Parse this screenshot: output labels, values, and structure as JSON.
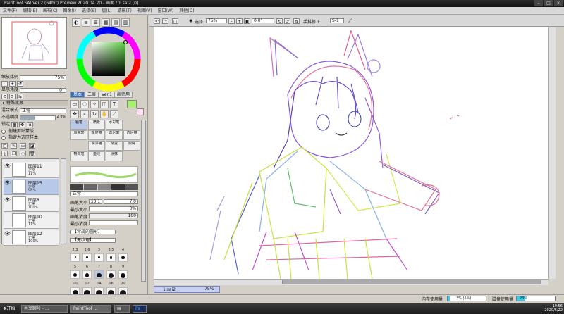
{
  "window": {
    "title": "PaintTool SAI Ver.2 (64bit) Preview.2020.04.20 - 画面 / 1.sai2 [0]",
    "controls": [
      "–",
      "□",
      "×"
    ]
  },
  "menu": [
    "文件(F)",
    "编辑(E)",
    "画布(C)",
    "图像(I)",
    "选择(S)",
    "层(L)",
    "滤镜(T)",
    "视图(V)",
    "窗口(W)",
    "其他(O)"
  ],
  "navigator": {
    "zoom_label": "缩放比例",
    "zoom_value": "75%",
    "angle_label": "显示角度",
    "angle_value": "0°"
  },
  "effects": {
    "header": "特殊效果",
    "blend_label": "混合模式",
    "blend_value": "正常",
    "opacity_label": "不透明度",
    "opacity_value": "43%",
    "lock_label": "锁定",
    "clip_label": "创建剪贴蒙版",
    "selsrc_label": "指定为选区样本"
  },
  "layers": [
    {
      "name": "图层11",
      "mode": "正常",
      "opacity": "11%",
      "selected": false,
      "visible": true
    },
    {
      "name": "图层15",
      "mode": "正常",
      "opacity": "98%",
      "selected": true,
      "visible": true
    },
    {
      "name": "图层8",
      "mode": "正常",
      "opacity": "100%",
      "selected": false,
      "visible": true
    },
    {
      "name": "图层10",
      "mode": "正常",
      "opacity": "11%",
      "selected": false,
      "visible": false
    },
    {
      "name": "图层12",
      "mode": "正常",
      "opacity": "100%",
      "selected": false,
      "visible": true
    }
  ],
  "toolpanel": {
    "color_tabs": [
      "基本",
      "二值",
      "Ver.1",
      "画师用"
    ],
    "tools": [
      {
        "name": "铅笔",
        "sel": true
      },
      {
        "name": "喷枪",
        "sel": false
      },
      {
        "name": "水彩笔",
        "sel": false
      },
      {
        "name": "马克笔",
        "sel": false
      },
      {
        "name": "橡皮擦",
        "sel": false
      },
      {
        "name": "选区笔",
        "sel": false
      },
      {
        "name": "选区擦",
        "sel": false
      },
      {
        "name": "油漆桶",
        "sel": false
      },
      {
        "name": "渐变",
        "sel": false
      },
      {
        "name": "模糊",
        "sel": false
      },
      {
        "name": "特效笔",
        "sel": false
      },
      {
        "name": "墨线",
        "sel": false
      },
      {
        "name": "涂抹",
        "sel": false
      }
    ],
    "blend_mode": "正常",
    "brush_size_label": "画笔大小",
    "brush_size_mult": "x0.1",
    "brush_size_value": "7.0",
    "min_size_label": "最小大小",
    "min_size_value": "0%",
    "density_label": "画笔浓度",
    "density_value": "100",
    "min_density_label": "最小浓度",
    "shape_label": "【常规的圆形】",
    "texture_label": "【无纹理】",
    "sizes": [
      "2.3",
      "2.6",
      "3",
      "3.5",
      "4",
      "5",
      "6",
      "7",
      "8",
      "9",
      "10",
      "12",
      "14",
      "16",
      "20"
    ]
  },
  "canvas_toolbar": {
    "select_label": "选择",
    "zoom": "75%",
    "angle": "0.0°",
    "stabilizer_label": "手抖修正",
    "stabilizer_value": "S-1"
  },
  "document": {
    "tab": "1.sai2",
    "zoom": "75%"
  },
  "status": {
    "memory_label": "内存使用量",
    "memory_value": "3% (5%)",
    "memory_frac": 0.05,
    "disk_label": "磁盘使用量",
    "disk_value": "23%",
    "disk_frac": 0.23
  },
  "taskbar": {
    "start": "开始",
    "tasks": [
      "共享聊号 - ...",
      "PaintTool ...",
      "",
      "Ps"
    ],
    "time": "19:56",
    "date": "2020/5/22"
  }
}
